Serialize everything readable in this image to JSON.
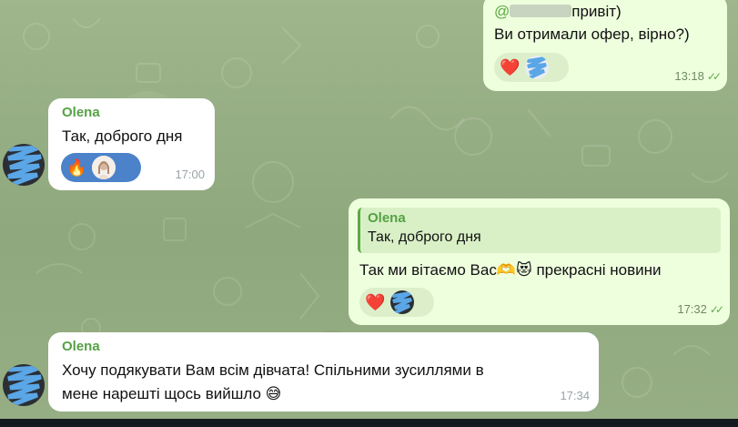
{
  "messages": [
    {
      "id": "m1",
      "direction": "outgoing",
      "mention_prefix": "@",
      "mention_suffix": "привіт)",
      "text": "Ви отримали офер, вірно?)",
      "reactions": [
        "❤️"
      ],
      "time": "13:18",
      "status": "read"
    },
    {
      "id": "m2",
      "direction": "incoming",
      "sender": "Olena",
      "text": "Так, доброго дня",
      "reactions": [
        "🔥"
      ],
      "time": "17:00"
    },
    {
      "id": "m3",
      "direction": "outgoing",
      "reply_to": {
        "sender": "Olena",
        "text": "Так, доброго дня"
      },
      "text": "Так ми вітаємо Вас🫶😻 прекрасні новини",
      "reactions": [
        "❤️"
      ],
      "time": "17:32",
      "status": "read"
    },
    {
      "id": "m4",
      "direction": "incoming",
      "sender": "Olena",
      "text_line1": "Хочу подякувати Вам всім дівчата! Спільними зусиллями в",
      "text_line2": "мене нарешті щось вийшло 😅",
      "time": "17:34"
    }
  ],
  "colors": {
    "background": "#97ad84",
    "incoming_bubble": "#ffffff",
    "outgoing_bubble": "#eeffde",
    "sender_name": "#55a145",
    "reaction_incoming": "#4b82c9",
    "redaction": "#5aa6e6"
  },
  "icons": {
    "read_status": "double-check-icon",
    "avatar_scribble": "redaction-scribble"
  }
}
